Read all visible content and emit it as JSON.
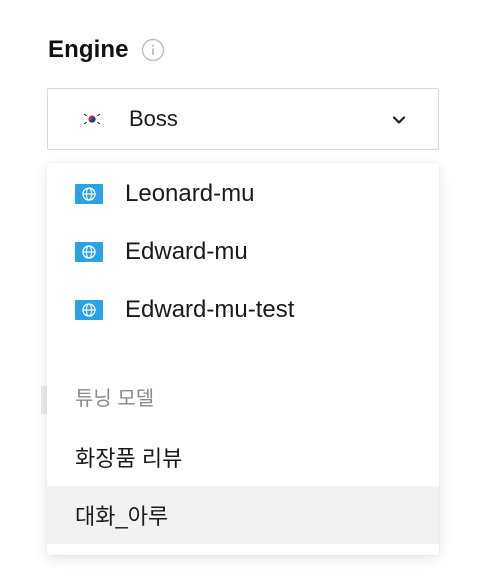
{
  "engine": {
    "label": "Engine",
    "info_icon": "info-icon",
    "selected": {
      "flag_icon": "korea-flag-icon",
      "value": "Boss"
    },
    "chevron_icon": "chevron-down-icon"
  },
  "dropdown": {
    "engine_options": [
      {
        "icon": "globe-icon",
        "label": "Leonard-mu"
      },
      {
        "icon": "globe-icon",
        "label": "Edward-mu"
      },
      {
        "icon": "globe-icon",
        "label": "Edward-mu-test"
      }
    ],
    "group": {
      "label": "튜닝 모델",
      "items": [
        {
          "label": "화장품 리뷰",
          "highlighted": false
        },
        {
          "label": "대화_아루",
          "highlighted": true
        }
      ]
    }
  },
  "colors": {
    "globe_bg": "#29a3e6",
    "border": "#d9d9d9",
    "highlight": "#f2f2f2",
    "group_label": "#8a8a8a"
  }
}
